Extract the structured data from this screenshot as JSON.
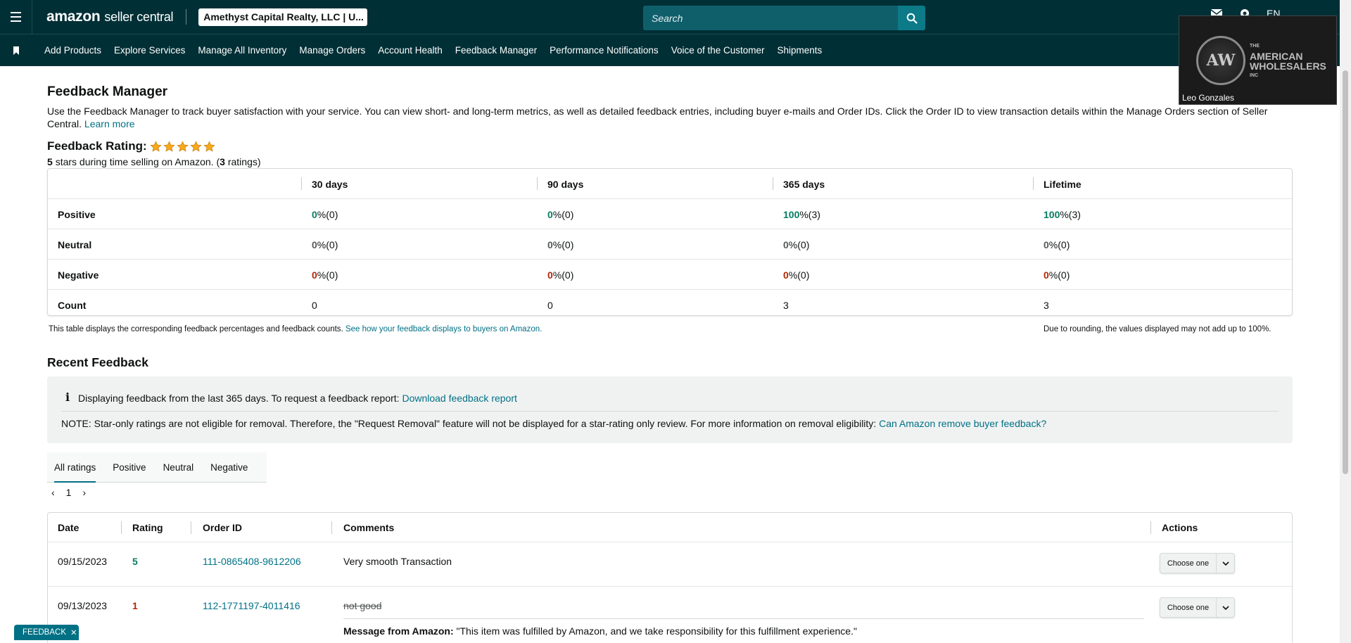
{
  "header": {
    "logo_brand": "amazon",
    "logo_product": "seller central",
    "account": "Amethyst Capital Realty, LLC | U...",
    "search_placeholder": "Search",
    "language": "EN"
  },
  "nav": {
    "items": [
      "Add Products",
      "Explore Services",
      "Manage All Inventory",
      "Manage Orders",
      "Account Health",
      "Feedback Manager",
      "Performance Notifications",
      "Voice of the Customer",
      "Shipments"
    ]
  },
  "video": {
    "brand_small": "THE",
    "brand_line1": "AMERICAN",
    "brand_line2": "WHOLESALERS",
    "brand_suffix": "INC",
    "participant": "Leo Gonzales"
  },
  "page": {
    "title": "Feedback Manager",
    "intro": "Use the Feedback Manager to track buyer satisfaction with your service. You can view short- and long-term metrics, as well as detailed feedback entries, including buyer e-mails and Order IDs. Click the Order ID to view transaction details within the Manage Orders section of Seller Central.",
    "learn_more": "Learn more",
    "rating_label": "Feedback Rating:",
    "star_count": 5,
    "rating_stars": "5",
    "rating_text_a": "stars during time selling on Amazon. (",
    "rating_count": "3",
    "rating_text_b": "ratings)"
  },
  "metrics": {
    "columns": [
      "30 days",
      "90 days",
      "365 days",
      "Lifetime"
    ],
    "rows": [
      {
        "label": "Positive",
        "cells": [
          [
            "0",
            " %(0)"
          ],
          [
            "0",
            " %(0)"
          ],
          [
            "100",
            " %(3)"
          ],
          [
            "100",
            " %(3)"
          ]
        ]
      },
      {
        "label": "Neutral",
        "cells": [
          [
            "0",
            " %(0)"
          ],
          [
            "0",
            " %(0)"
          ],
          [
            "0",
            " %(0)"
          ],
          [
            "0",
            " %(0)"
          ]
        ]
      },
      {
        "label": "Negative",
        "cells": [
          [
            "0",
            " %(0)"
          ],
          [
            "0",
            " %(0)"
          ],
          [
            "0",
            " %(0)"
          ],
          [
            "0",
            " %(0)"
          ]
        ]
      },
      {
        "label": "Count",
        "cells": [
          [
            "",
            "0"
          ],
          [
            "",
            "0"
          ],
          [
            "",
            "3"
          ],
          [
            "",
            "3"
          ]
        ]
      }
    ],
    "note_left": "This table displays the corresponding feedback percentages and feedback counts.",
    "note_left_link": "See how your feedback displays to buyers on Amazon.",
    "note_right": "Due to rounding, the values displayed may not add up to 100%."
  },
  "recent": {
    "title": "Recent Feedback",
    "info_line1": "Displaying feedback from the last 365 days. To request a feedback report:",
    "info_link1": "Download feedback report",
    "info_line2": "NOTE: Star-only ratings are not eligible for removal. Therefore, the \"Request Removal\" feature will not be displayed for a star-rating only review. For more information on removal eligibility:",
    "info_link2": "Can Amazon remove buyer feedback?",
    "tabs": [
      "All ratings",
      "Positive",
      "Neutral",
      "Negative"
    ],
    "page": "1"
  },
  "feedback_table": {
    "headers": [
      "Date",
      "Rating",
      "Order ID",
      "Comments",
      "Actions"
    ],
    "rows": [
      {
        "date": "09/15/2023",
        "rating": "5",
        "order_id": "111-0865408-9612206",
        "comment": "Very smooth Transaction",
        "action": "Choose one"
      },
      {
        "date": "09/13/2023",
        "rating": "1",
        "order_id": "112-1771197-4011416",
        "comment": "not good",
        "message_label": "Message from Amazon:",
        "message": "\"This item was fulfilled by Amazon, and we take responsibility for this fulfillment experience.\"",
        "action": "Choose one"
      }
    ]
  },
  "feedback_pill": "FEEDBACK",
  "colors": {
    "header_bg": "#002f36",
    "link": "#007185",
    "positive": "#067d62",
    "negative": "#b12704",
    "star": "#f7a81b"
  }
}
